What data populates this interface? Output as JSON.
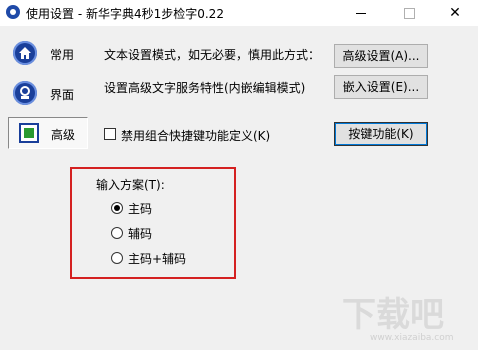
{
  "window": {
    "title": "使用设置 - 新华字典4秒1步检字0.22",
    "close_glyph": "✕"
  },
  "nav": [
    {
      "label": "常用",
      "icon": "home-icon"
    },
    {
      "label": "界面",
      "icon": "interface-icon"
    },
    {
      "label": "高级",
      "icon": "advanced-icon",
      "active": true
    }
  ],
  "advanced": {
    "row1_text": "文本设置模式，如无必要，慎用此方式：",
    "row1_button": "高级设置(A)...",
    "row2_text": "设置高级文字服务特性(内嵌编辑模式)",
    "row2_button": "嵌入设置(E)...",
    "row3_checkbox_label": "禁用组合快捷键功能定义(K)",
    "row3_checkbox_checked": false,
    "row3_button": "按键功能(K)"
  },
  "input_scheme": {
    "label": "输入方案(T):",
    "options": [
      {
        "label": "主码",
        "checked": true
      },
      {
        "label": "辅码",
        "checked": false
      },
      {
        "label": "主码+辅码",
        "checked": false
      }
    ]
  },
  "watermark": {
    "text": "下载吧",
    "url": "www.xiazaiba.com"
  },
  "colors": {
    "accent_blue": "#1a3f9a",
    "highlight_red": "#d42020",
    "icon_green": "#2a9a30"
  }
}
